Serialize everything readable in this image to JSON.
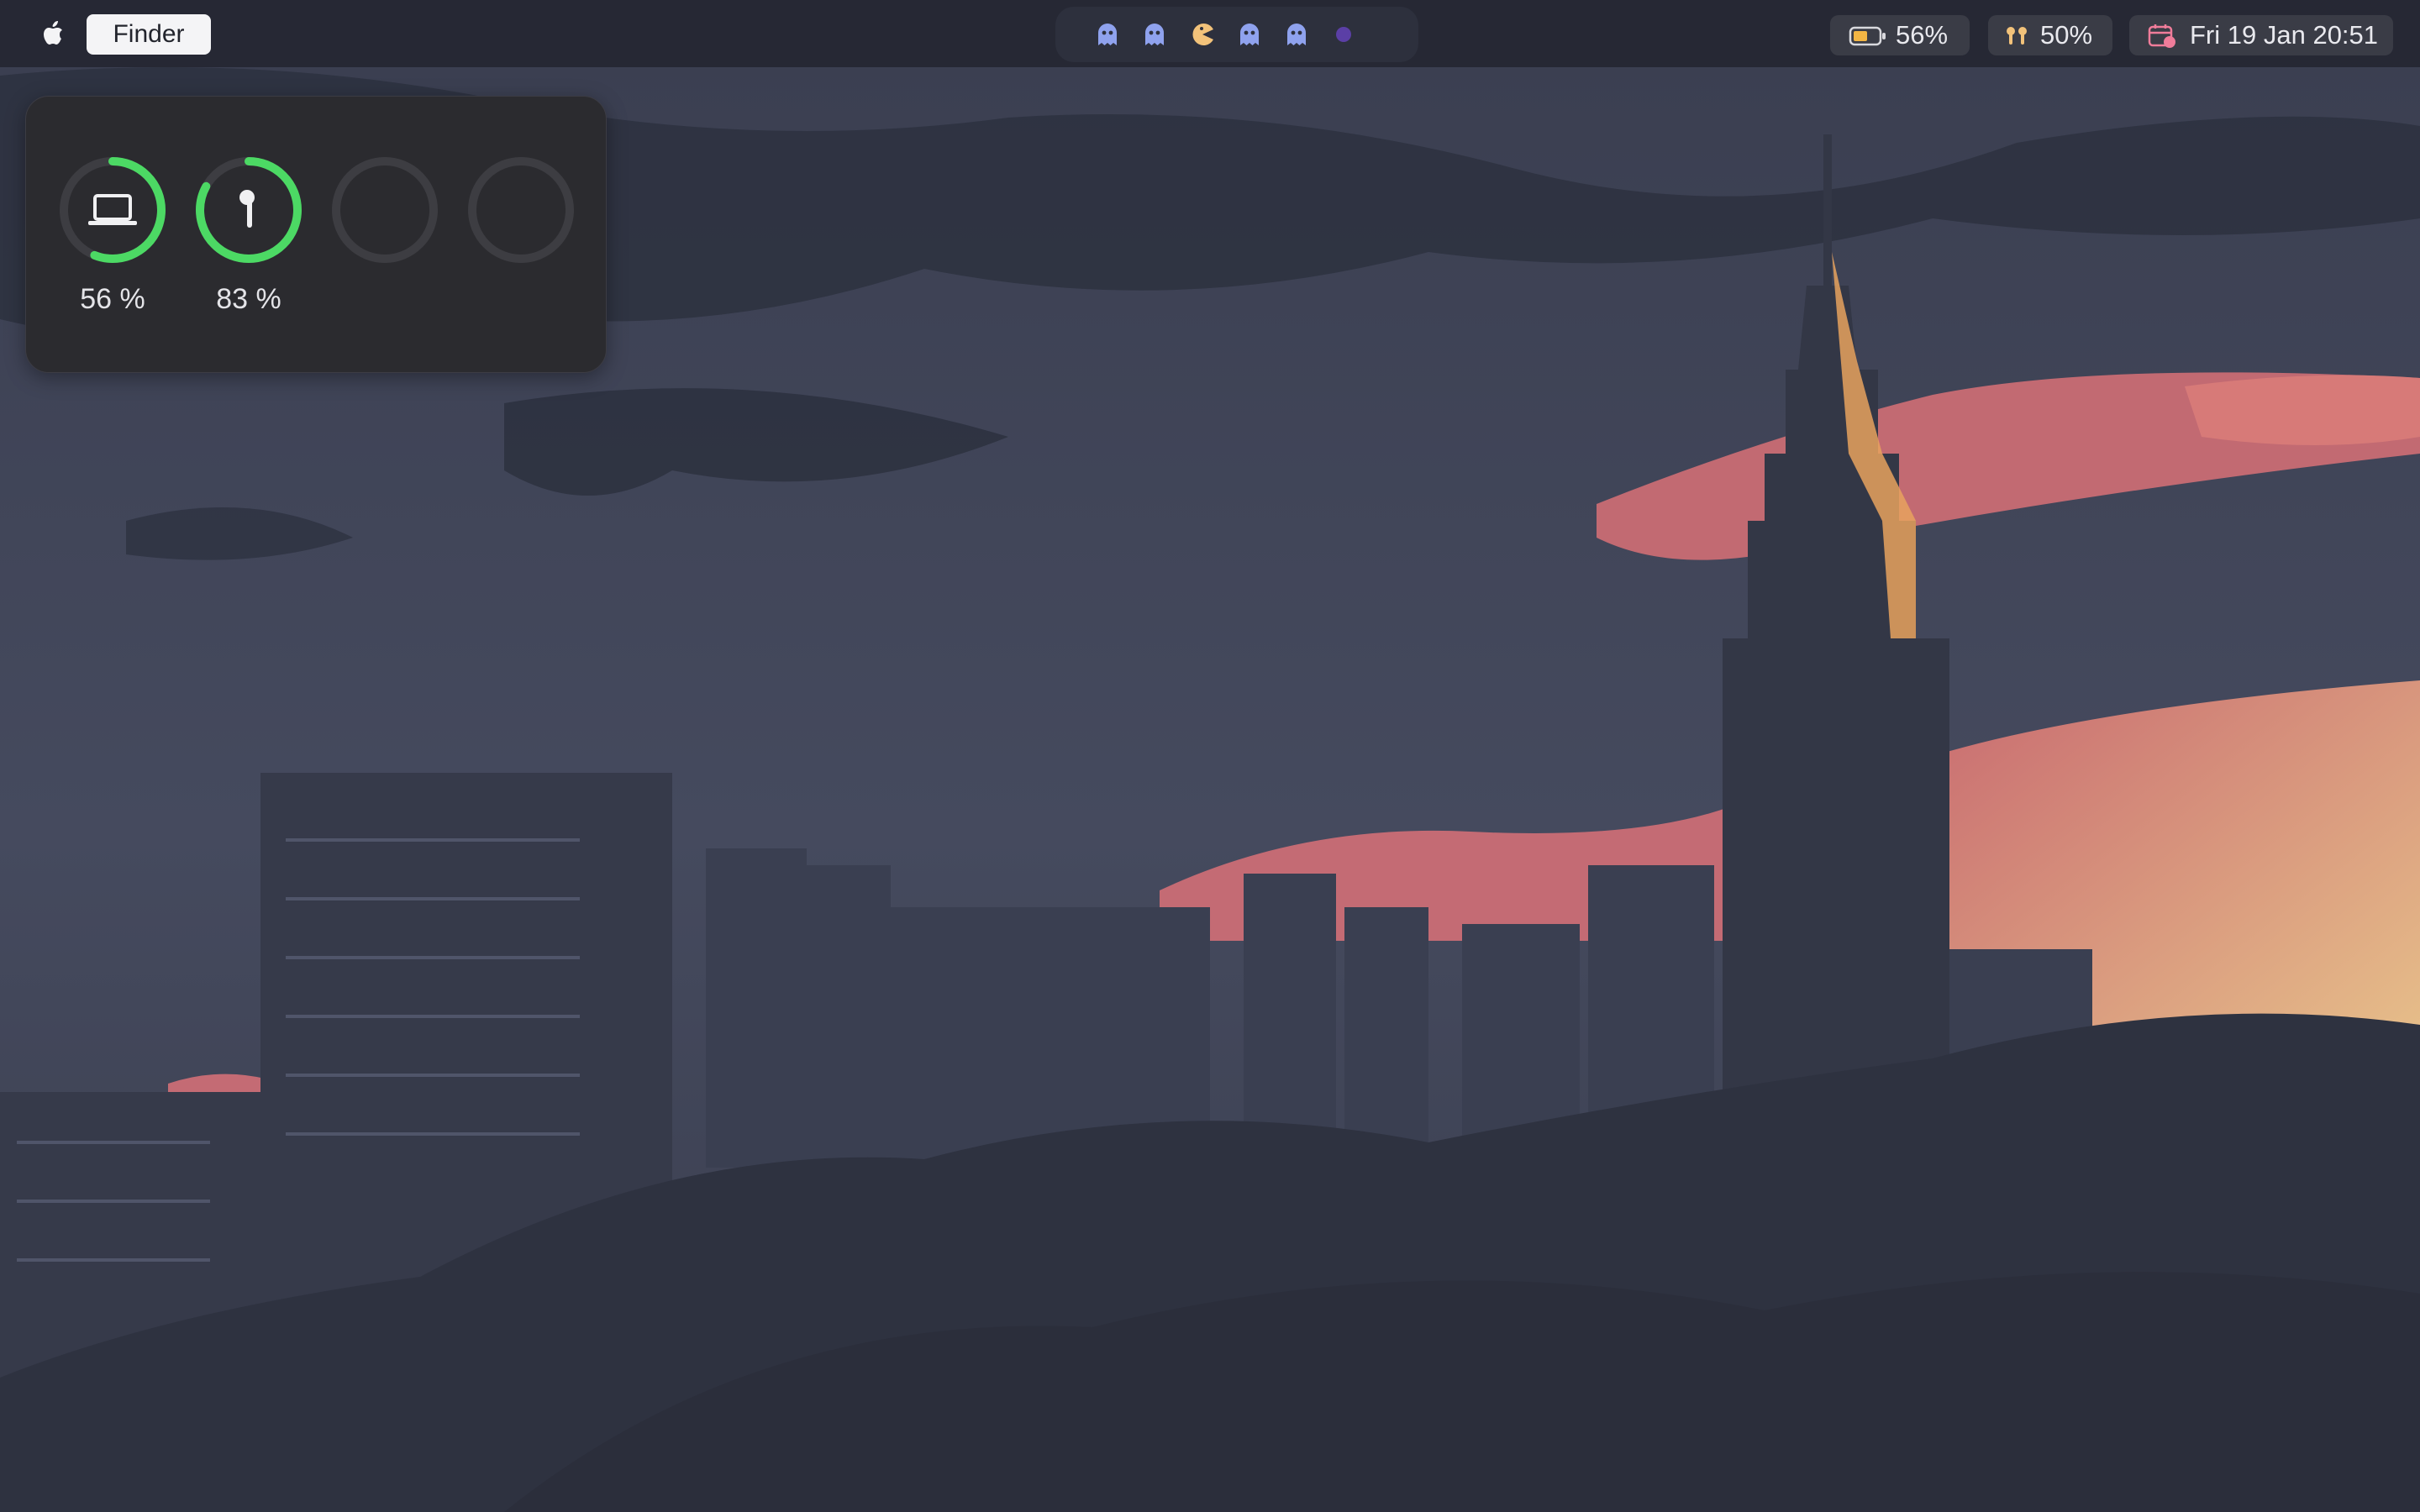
{
  "menubar": {
    "app_name": "Finder",
    "spaces": [
      "ghost-icon",
      "ghost-icon",
      "pacman-icon",
      "ghost-icon",
      "ghost-icon",
      "dot-icon"
    ],
    "battery_text": "56%",
    "airpods_text": "50%",
    "datetime": "Fri 19 Jan 20:51"
  },
  "widget": {
    "devices": [
      {
        "icon": "laptop-icon",
        "label": "56 %",
        "level": 0.56
      },
      {
        "icon": "airpod-icon",
        "label": "83 %",
        "level": 0.83
      },
      {
        "icon": "",
        "label": "",
        "level": 0
      },
      {
        "icon": "",
        "label": "",
        "level": 0
      }
    ]
  },
  "colors": {
    "ring_green": "#4cd964",
    "ring_track": "#3d3d42",
    "ghost": "#8fa2ee",
    "pacman": "#f2c27a",
    "dot": "#5b3fa6",
    "calendar_pink": "#f07c9a"
  }
}
